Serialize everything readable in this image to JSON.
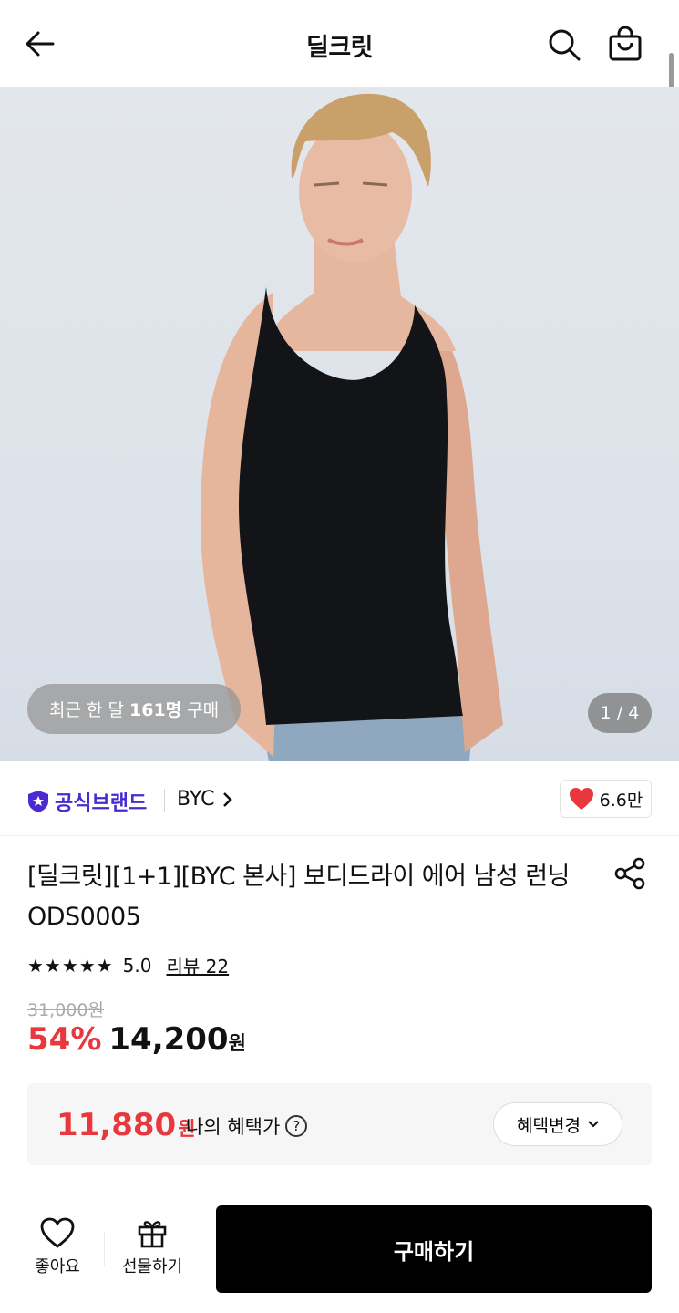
{
  "header": {
    "title": "딜크릿",
    "back_icon": "arrow-left-icon",
    "search_icon": "search-icon",
    "cart_icon": "shopping-bag-icon"
  },
  "hero": {
    "purchase_prefix": "최근 한 달",
    "purchase_count": "161명",
    "purchase_suffix": "구매",
    "page_indicator": "1 / 4"
  },
  "brand": {
    "official_label": "공식브랜드",
    "name": "BYC",
    "like_count": "6.6만"
  },
  "product": {
    "title": "[딜크릿][1+1][BYC 본사] 보디드라이 에어 남성 런닝 ODS0005",
    "stars": "★★★★★",
    "rating": "5.0",
    "review_label": "리뷰 22",
    "original_price": "31,000원",
    "discount": "54%",
    "sale_price": "14,200",
    "won": "원"
  },
  "benefit": {
    "amount": "11,880",
    "won": "원",
    "label": "나의 혜택가",
    "help": "?",
    "change_label": "혜택변경"
  },
  "bottom_bar": {
    "like_label": "좋아요",
    "gift_label": "선물하기",
    "buy_label": "구매하기"
  },
  "colors": {
    "accent_red": "#e8383d",
    "brand_purple": "#4a2bd1",
    "buy_button": "#000000"
  }
}
